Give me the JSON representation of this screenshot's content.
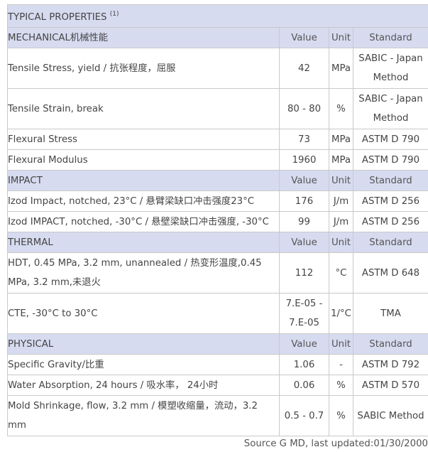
{
  "title": "TYPICAL PROPERTIES",
  "title_note": "(1)",
  "sections": [
    {
      "name": "MECHANICAL机械性能",
      "col_value": "Value",
      "col_unit": "Unit",
      "col_standard": "Standard",
      "rows": [
        {
          "property": "Tensile Stress, yield / 抗张程度，屈服",
          "value": "42",
          "unit": "MPa",
          "standard": "SABIC - Japan Method"
        },
        {
          "property": "Tensile Strain, break",
          "value": "80 - 80",
          "unit": "%",
          "standard": "SABIC - Japan Method"
        },
        {
          "property": "Flexural Stress",
          "value": "73",
          "unit": "MPa",
          "standard": "ASTM D 790"
        },
        {
          "property": "Flexural Modulus",
          "value": "1960",
          "unit": "MPa",
          "standard": "ASTM D 790"
        }
      ]
    },
    {
      "name": "IMPACT",
      "col_value": "Value",
      "col_unit": "Unit",
      "col_standard": "Standard",
      "rows": [
        {
          "property": "Izod Impact, notched, 23°C / 悬臂梁缺口冲击强度23°C",
          "value": "176",
          "unit": "J/m",
          "standard": "ASTM D 256"
        },
        {
          "property": "Izod IMPACT, notched, -30°C / 悬壁梁缺口冲击强度, -30°C",
          "value": "99",
          "unit": "J/m",
          "standard": "ASTM D 256"
        }
      ]
    },
    {
      "name": "THERMAL",
      "col_value": "Value",
      "col_unit": "Unit",
      "col_standard": "Standard",
      "rows": [
        {
          "property": "HDT, 0.45 MPa, 3.2 mm, unannealed / 热变形温度,0.45 MPa, 3.2 mm,未退火",
          "value": "112",
          "unit": "°C",
          "standard": "ASTM D 648"
        },
        {
          "property": "CTE, -30°C to 30°C",
          "value": "7.E-05 - 7.E-05",
          "unit": "1/°C",
          "standard": "TMA"
        }
      ]
    },
    {
      "name": "PHYSICAL",
      "col_value": "Value",
      "col_unit": "Unit",
      "col_standard": "Standard",
      "rows": [
        {
          "property": "Specific Gravity/比重",
          "value": "1.06",
          "unit": "-",
          "standard": "ASTM D 792"
        },
        {
          "property": "Water Absorption, 24 hours / 吸水率， 24小时",
          "value": "0.06",
          "unit": "%",
          "standard": "ASTM D 570"
        },
        {
          "property": "Mold Shrinkage, flow, 3.2 mm / 模塑收缩量，流动，3.2 mm",
          "value": "0.5 - 0.7",
          "unit": "%",
          "standard": "SABIC Method"
        }
      ]
    }
  ],
  "footer": "Source G MD, last updated:01/30/2000"
}
